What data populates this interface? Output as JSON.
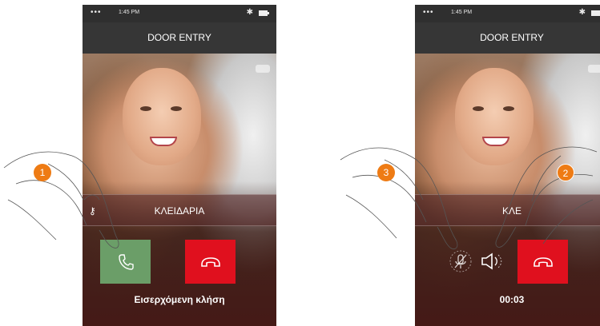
{
  "screens": [
    {
      "status": {
        "signal": "••• ",
        "wifi": "ᯤ",
        "time": "1:45 PM",
        "bluetooth": "✱"
      },
      "title": "DOOR ENTRY",
      "lock_label": "ΚΛΕΙΔΑΡΙΑ",
      "lock_icon": "key-icon",
      "footer": "Εισερχόμενη κλήση",
      "answer_color": "#6b9e68",
      "hangup_color": "#e0101e"
    },
    {
      "status": {
        "signal": "••• ",
        "wifi": "ᯤ",
        "time": "1:45 PM",
        "bluetooth": "✱"
      },
      "title": "DOOR ENTRY",
      "lock_label": "ΚΛΕ",
      "footer": "00:03",
      "hangup_color": "#e0101e"
    }
  ],
  "steps": [
    "1",
    "2",
    "3"
  ],
  "accent_color": "#ee7b14"
}
